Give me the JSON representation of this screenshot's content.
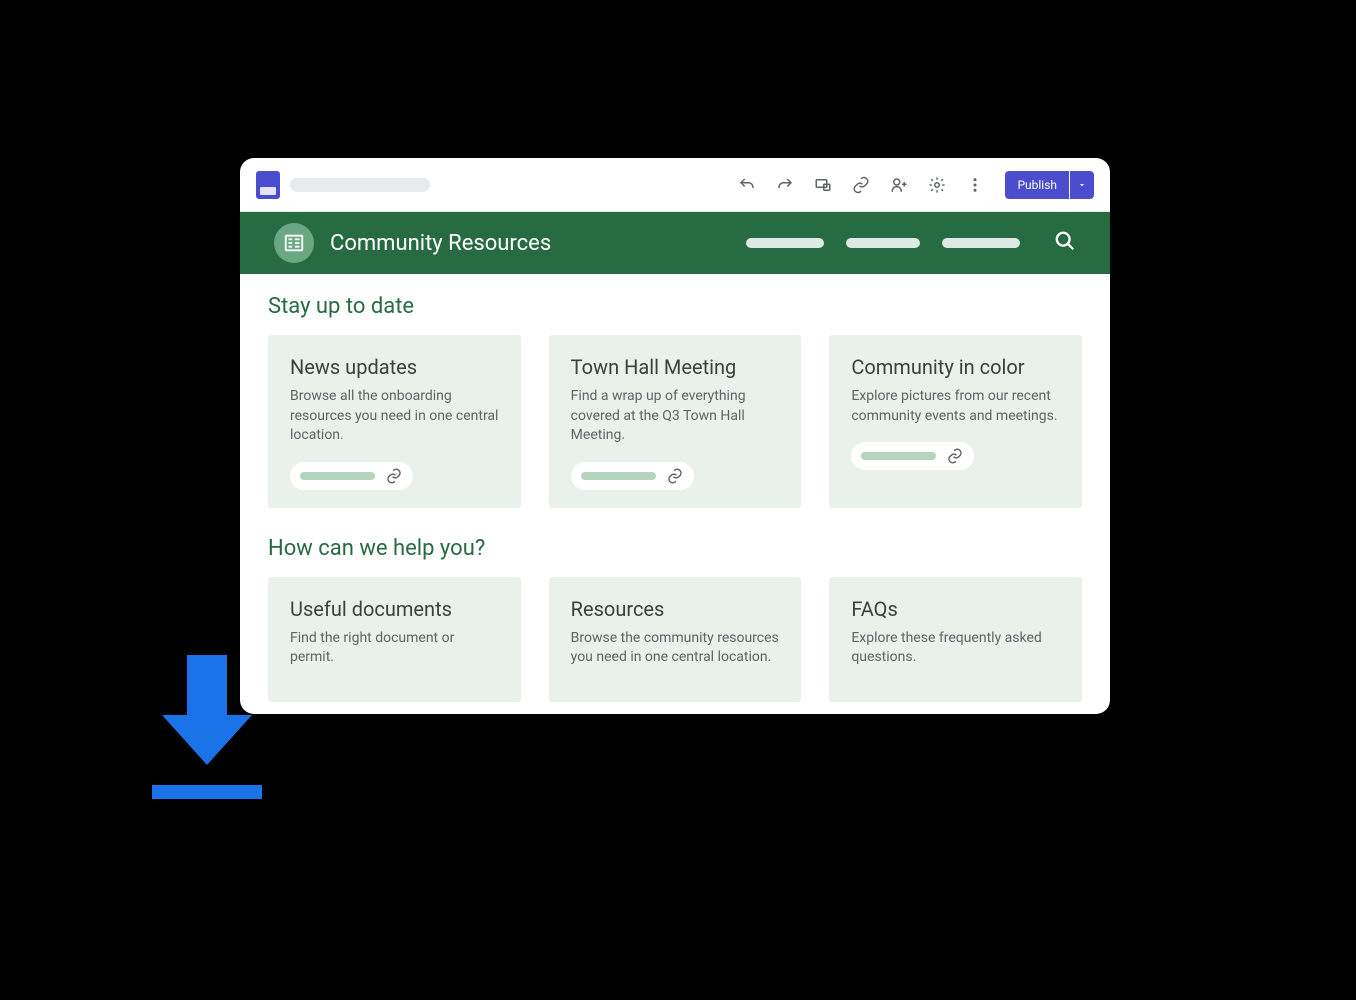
{
  "toolbar": {
    "publish_label": "Publish"
  },
  "site": {
    "title": "Community Resources"
  },
  "sections": [
    {
      "heading": "Stay up to date",
      "cards": [
        {
          "title": "News updates",
          "desc": "Browse all the onboarding resources you need in one central location."
        },
        {
          "title": "Town Hall Meeting",
          "desc": "Find a wrap up of everything covered at the Q3 Town Hall Meeting."
        },
        {
          "title": "Community in color",
          "desc": "Explore pictures from our recent community events and meetings."
        }
      ]
    },
    {
      "heading": "How can we help you?",
      "cards": [
        {
          "title": "Useful documents",
          "desc": "Find the right document or permit."
        },
        {
          "title": "Resources",
          "desc": "Browse the community resources you need in one central location."
        },
        {
          "title": "FAQs",
          "desc": "Explore these frequently asked questions."
        }
      ]
    }
  ]
}
